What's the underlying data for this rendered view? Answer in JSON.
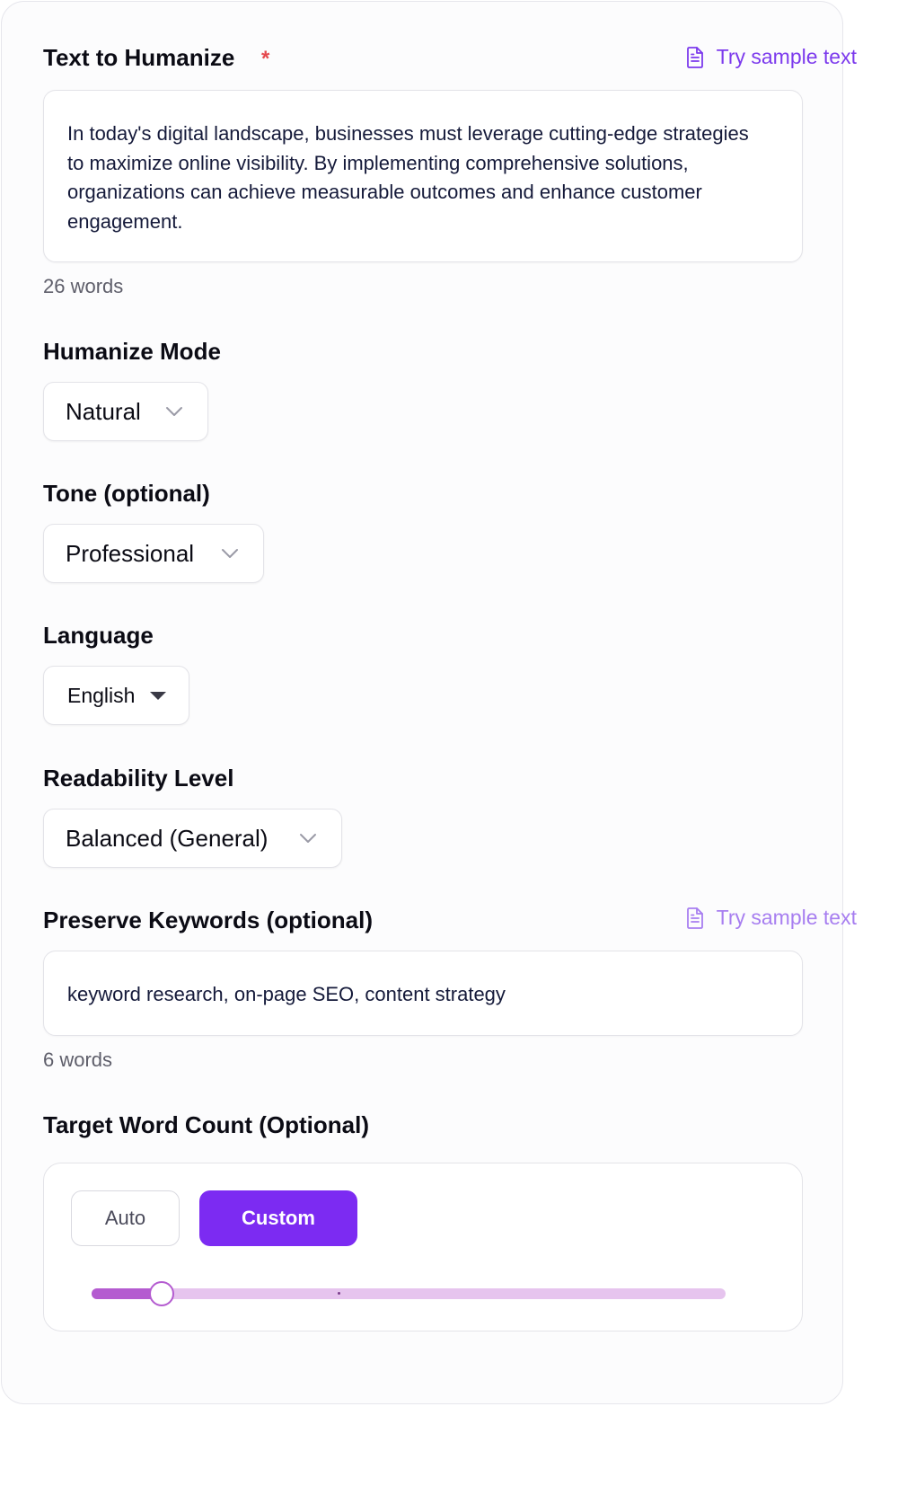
{
  "text_to_humanize": {
    "label": "Text to Humanize",
    "required_mark": "*",
    "sample_link": "Try sample text",
    "value": "In today's digital landscape, businesses must leverage cutting-edge strategies to maximize online visibility. By implementing comprehensive solutions, organizations can achieve measurable outcomes and enhance customer engagement.",
    "word_count": "26 words"
  },
  "humanize_mode": {
    "label": "Humanize Mode",
    "value": "Natural"
  },
  "tone": {
    "label": "Tone (optional)",
    "value": "Professional"
  },
  "language": {
    "label": "Language",
    "value": "English"
  },
  "readability": {
    "label": "Readability Level",
    "value": "Balanced (General)"
  },
  "preserve_keywords": {
    "label": "Preserve Keywords (optional)",
    "sample_link": "Try sample text",
    "value": "keyword research, on-page SEO, content strategy",
    "word_count": "6 words"
  },
  "target_word_count": {
    "label": "Target Word Count (Optional)",
    "auto_label": "Auto",
    "custom_label": "Custom",
    "selected_mode": "Custom",
    "slider_fraction": 0.11
  },
  "colors": {
    "accent": "#7c3aed",
    "button_active": "#7c2bf2",
    "required": "#e5484d",
    "slider_fill": "#b45bd0",
    "slider_track": "#e6c4ee"
  },
  "icons": {
    "sample": "document-icon",
    "chevron": "chevron-down-icon",
    "caret": "caret-down-icon"
  }
}
